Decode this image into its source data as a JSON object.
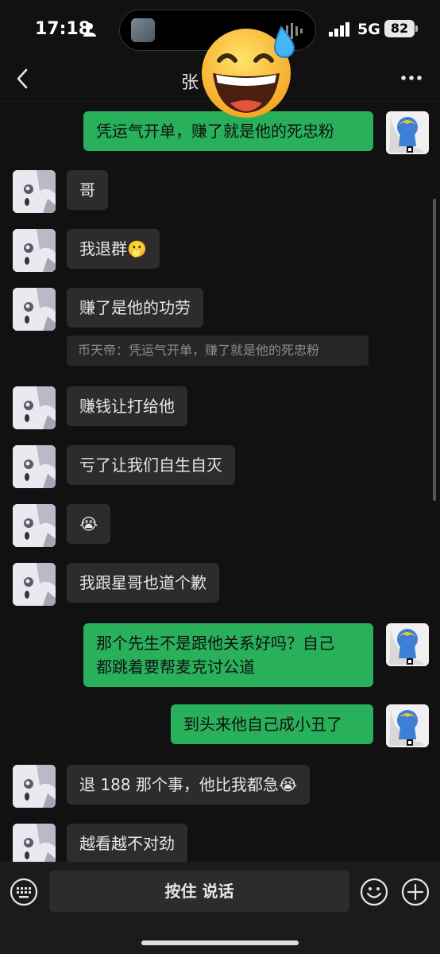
{
  "status": {
    "time": "17:18",
    "network": "5G",
    "battery": "82"
  },
  "header": {
    "title": "张"
  },
  "messages": [
    {
      "side": "out",
      "text": "凭运气开单，赚了就是他的死忠粉"
    },
    {
      "side": "in",
      "text": "哥"
    },
    {
      "side": "in",
      "text": "我退群🫢"
    },
    {
      "side": "in",
      "text": "赚了是他的功劳",
      "quote": "币天帝：凭运气开单，赚了就是他的死忠粉"
    },
    {
      "side": "in",
      "text": "赚钱让打给他"
    },
    {
      "side": "in",
      "text": "亏了让我们自生自灭"
    },
    {
      "side": "in",
      "text": "😭"
    },
    {
      "side": "in",
      "text": "我跟星哥也道个歉"
    },
    {
      "side": "out",
      "line1": "那个先生不是跟他关系好吗？自己",
      "line2": "都跳着要帮麦克讨公道"
    },
    {
      "side": "out",
      "text": "到头来他自己成小丑了"
    },
    {
      "side": "in",
      "text": "退 188 那个事，他比我都急😭"
    },
    {
      "side": "in",
      "text": "越看越不对劲"
    }
  ],
  "input_bar": {
    "hold_to_talk": "按住 说话"
  },
  "icons": [
    "person-icon",
    "back-icon",
    "more-icon",
    "keyboard-icon",
    "emoji-icon",
    "plus-icon",
    "grinning-sweat-emoji"
  ],
  "colors": {
    "background": "#111111",
    "incoming_bubble": "#2c2c2c",
    "outgoing_bubble": "#29b05a"
  }
}
